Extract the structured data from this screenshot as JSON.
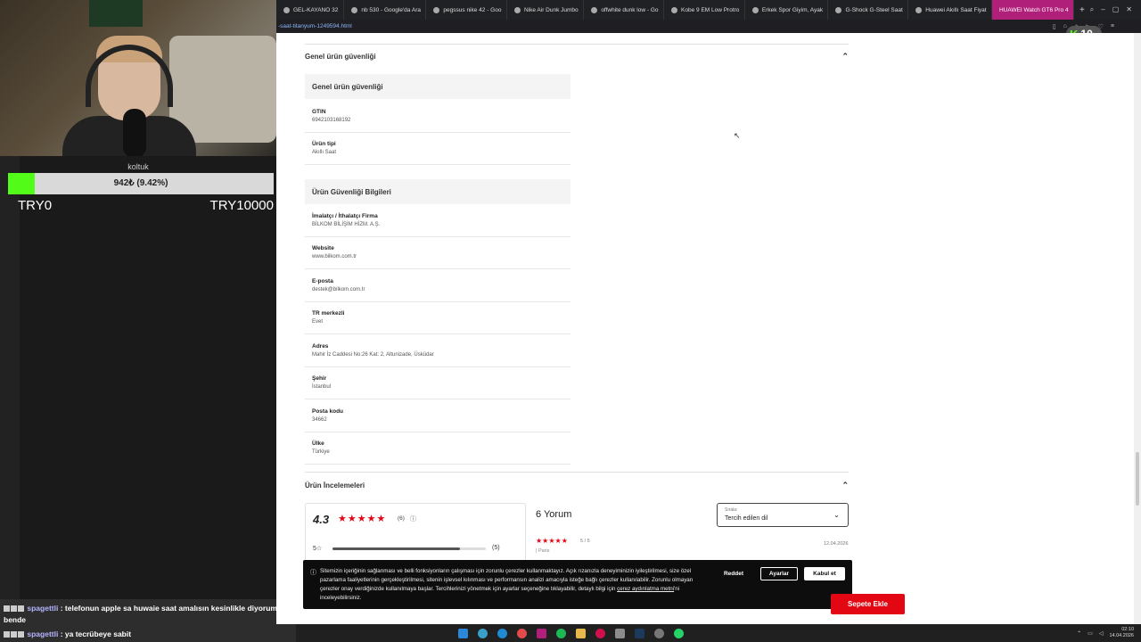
{
  "browser": {
    "tabs": [
      {
        "label": "GEL-KAYANO 32",
        "active": false
      },
      {
        "label": "nb 530 - Google'da Ara",
        "active": false
      },
      {
        "label": "pegssus nike 42 - Goo",
        "active": false
      },
      {
        "label": "Nike Air Dunk Jumbo",
        "active": false
      },
      {
        "label": "offwhite dunk low - Go",
        "active": false
      },
      {
        "label": "Kobe 9 EM Low Protro",
        "active": false
      },
      {
        "label": "Erkek Spor Giyim, Ayak",
        "active": false
      },
      {
        "label": "G-Shock G-Steel Saat",
        "active": false
      },
      {
        "label": "Huawei Akıllı Saat Fiyat",
        "active": false
      },
      {
        "label": "HUAWEI Watch GT6 Pro 4",
        "active": true
      }
    ],
    "url": "-saat-titanyum-1249594.html",
    "badge_number": "10",
    "badge_letter": "K"
  },
  "safety": {
    "title": "Genel ürün güvenliği",
    "group1_title": "Genel ürün güvenliği",
    "group1": [
      {
        "key": "GTIN",
        "value": "6942103168192"
      },
      {
        "key": "Ürün tipi",
        "value": "Akıllı Saat"
      }
    ],
    "group2_title": "Ürün Güvenliği Bilgileri",
    "group2": [
      {
        "key": "İmalatçı / İthalatçı Firma",
        "value": "BİLKOM BİLİŞİM HİZM. A.Ş."
      },
      {
        "key": "Website",
        "value": "www.bilkom.com.tr"
      },
      {
        "key": "E-posta",
        "value": "destek@bilkom.com.tr"
      },
      {
        "key": "TR merkezli",
        "value": "Evet"
      },
      {
        "key": "Adres",
        "value": "Mahir İz Caddesi No:26 Kat: 2, Altunizade, Üsküdar"
      },
      {
        "key": "Şehir",
        "value": "İstanbul"
      },
      {
        "key": "Posta kodu",
        "value": "34662"
      },
      {
        "key": "Ülke",
        "value": "Türkiye"
      }
    ]
  },
  "reviews": {
    "title": "Ürün İncelemeleri",
    "rating": "4.3",
    "stars": "★★★★★",
    "count": "(6)",
    "bar_label": "5☆",
    "bar_fraction": 0.83,
    "bar_count": "(5)",
    "total_title": "6 Yorum",
    "sort_label": "Sırala:",
    "sort_value": "Tercih edilen dil",
    "review_stars": "★★★★★",
    "review_score": "5 / 5",
    "review_date": "12.04.2026",
    "review_author": "| Paris"
  },
  "cookie": {
    "text": "Sitemizin içeriğinin sağlanması ve belli fonksiyonların çalışması için zorunlu çerezler kullanmaktayız. Açık rızanızla deneyiminizin iyileştirilmesi, size özel pazarlama faaliyetlerinin gerçekleştirilmesi, sitenin işlevsel kılınması ve performansın analizi amacıyla isteğe bağlı çerezler kullanılabilir. Zorunlu olmayan çerezler onay verdiğinizde kullanılmaya başlar. Tercihlerinizi yönetmek için ayarlar seçeneğine tıklayabilir, detaylı bilgi için ",
    "link": "çerez aydınlatma metni",
    "text_end": "'ni inceleyebilirsiniz.",
    "reject": "Reddet",
    "settings": "Ayarlar",
    "accept": "Kabul et"
  },
  "cart_button": "Sepete Ekle",
  "stream": {
    "goal_label": "koltuk",
    "goal_text": "942₺ (9.42%)",
    "goal_fraction": 0.0942,
    "goal_min": "TRY0",
    "goal_max": "TRY10000",
    "chat": [
      {
        "user": "spagettli",
        "text": ": telefonun apple sa huwaie saat amalısın kesinlikle diyorum bende"
      },
      {
        "user": "spagettli",
        "text": ": ya tecrübeye sabit"
      }
    ]
  },
  "taskbar": {
    "time": "02:10",
    "date": "14.04.2026"
  },
  "colors": {
    "brand_red": "#e30613",
    "kick_green": "#53fc18",
    "active_tab": "#b01f7a"
  }
}
